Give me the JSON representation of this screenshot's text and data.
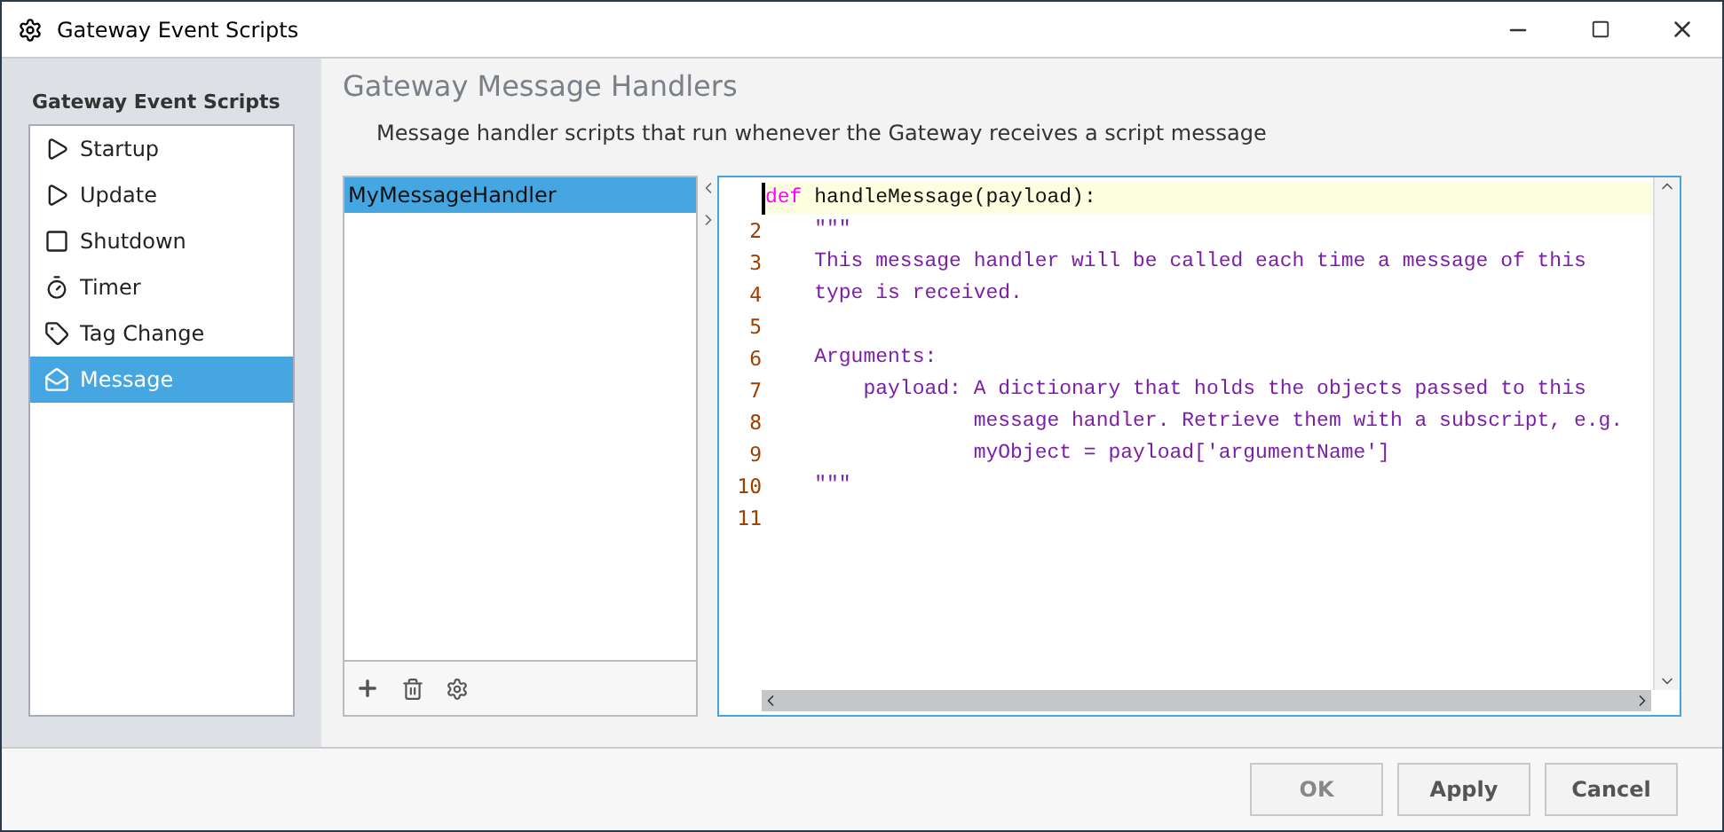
{
  "window": {
    "title": "Gateway Event Scripts"
  },
  "sidebar": {
    "title": "Gateway Event Scripts",
    "items": [
      {
        "label": "Startup",
        "kind": "play",
        "selected": false
      },
      {
        "label": "Update",
        "kind": "play",
        "selected": false
      },
      {
        "label": "Shutdown",
        "kind": "stop",
        "selected": false
      },
      {
        "label": "Timer",
        "kind": "timer",
        "selected": false
      },
      {
        "label": "Tag Change",
        "kind": "tag",
        "selected": false
      },
      {
        "label": "Message",
        "kind": "message",
        "selected": true
      }
    ]
  },
  "main": {
    "title": "Gateway Message Handlers",
    "description": "Message handler scripts that run whenever the Gateway receives a script message",
    "handlers": [
      {
        "label": "MyMessageHandler",
        "selected": true
      }
    ],
    "editor": {
      "lines": [
        {
          "current": true,
          "segments": [
            {
              "kind": "keyword",
              "text": "def"
            },
            {
              "kind": "plain",
              "text": " handleMessage(payload):"
            }
          ]
        },
        {
          "number": "2",
          "current": false,
          "segments": [
            {
              "kind": "string",
              "text": "    \"\"\""
            }
          ]
        },
        {
          "number": "3",
          "current": false,
          "segments": [
            {
              "kind": "string",
              "text": "    This message handler will be called each time a message of this"
            }
          ]
        },
        {
          "number": "4",
          "current": false,
          "segments": [
            {
              "kind": "string",
              "text": "    type is received."
            }
          ]
        },
        {
          "number": "5",
          "current": false
        },
        {
          "number": "6",
          "current": false,
          "segments": [
            {
              "kind": "string",
              "text": "    Arguments:"
            }
          ]
        },
        {
          "number": "7",
          "current": false,
          "segments": [
            {
              "kind": "string",
              "text": "        payload: A dictionary that holds the objects passed to this"
            }
          ]
        },
        {
          "number": "8",
          "current": false,
          "segments": [
            {
              "kind": "string",
              "text": "                 message handler. Retrieve them with a subscript, e.g."
            }
          ]
        },
        {
          "number": "9",
          "current": false,
          "segments": [
            {
              "kind": "string",
              "text": "                 myObject = payload['argumentName']"
            }
          ]
        },
        {
          "number": "10",
          "current": false,
          "segments": [
            {
              "kind": "string",
              "text": "    \"\"\""
            }
          ]
        },
        {
          "number": "11",
          "current": false
        }
      ]
    }
  },
  "buttons": [
    {
      "label": "OK",
      "disabled": true
    },
    {
      "label": "Apply",
      "disabled": false
    },
    {
      "label": "Cancel",
      "disabled": false
    }
  ]
}
